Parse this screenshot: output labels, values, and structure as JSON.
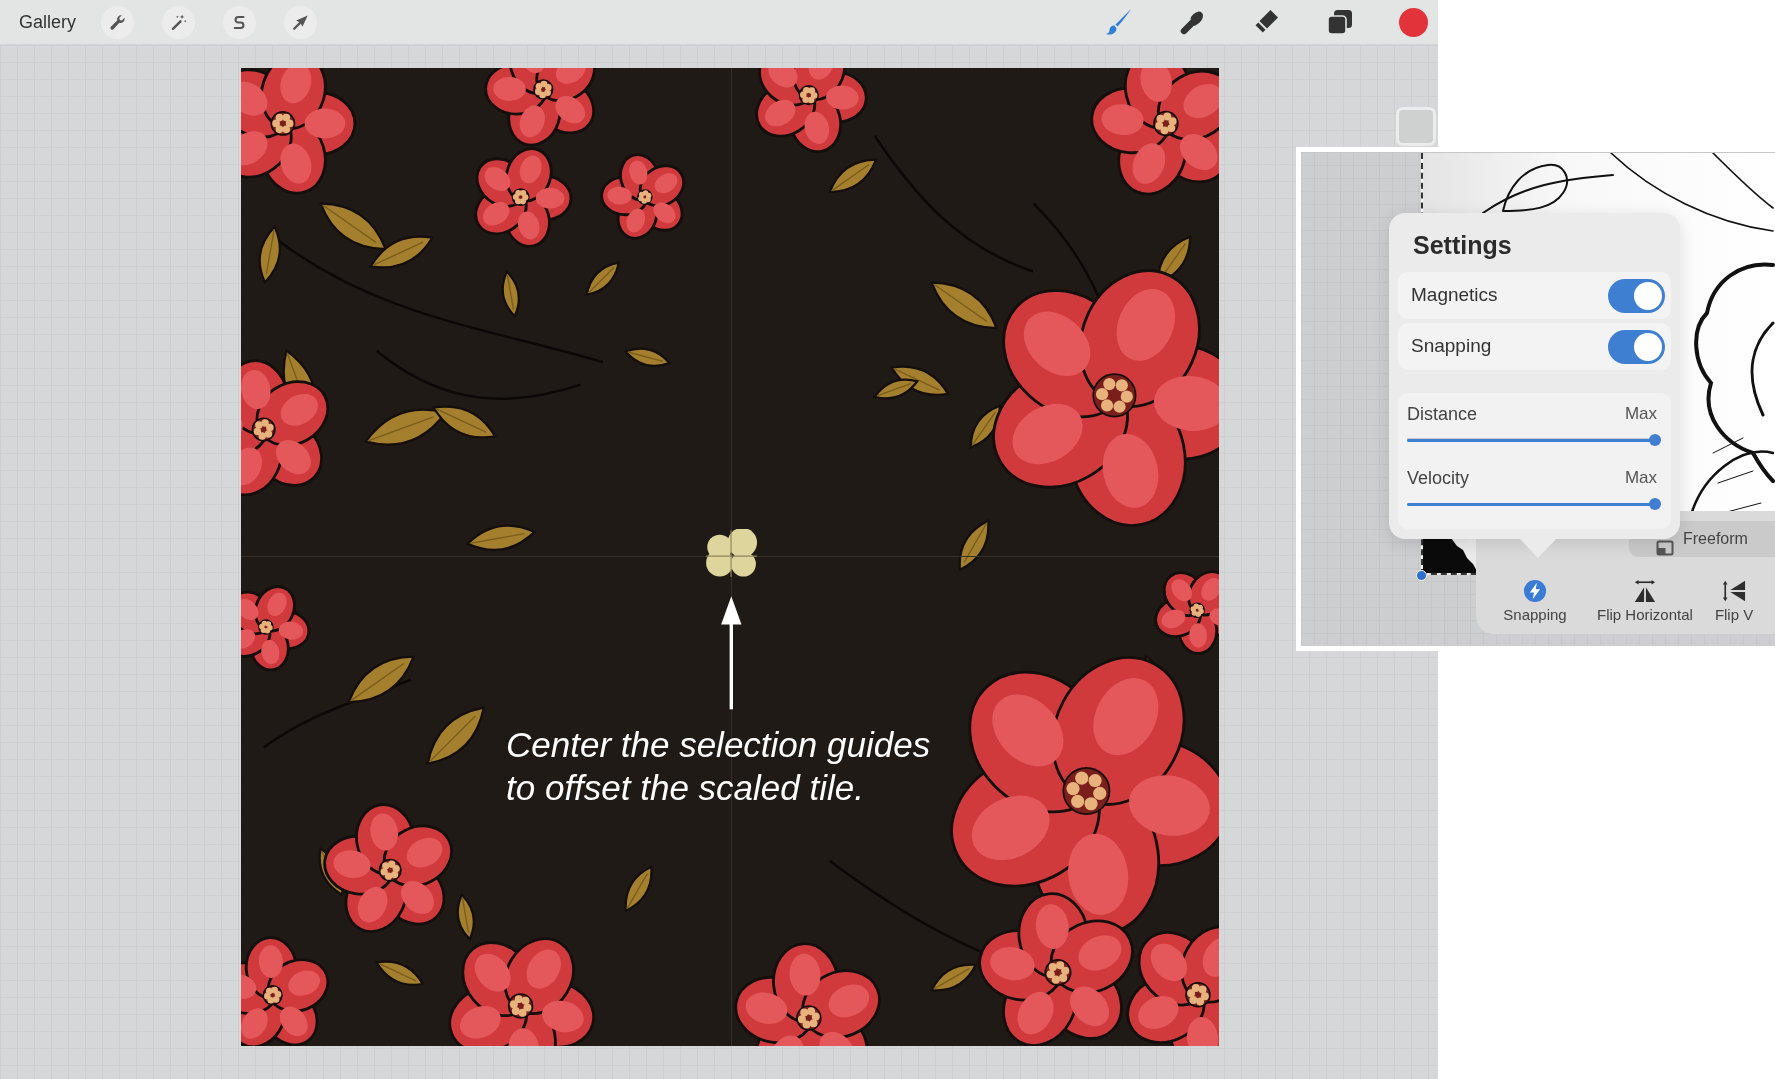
{
  "toolbar": {
    "gallery": "Gallery",
    "tools": [
      {
        "kind": "brush",
        "selected": true
      },
      {
        "kind": "smudge",
        "selected": false
      },
      {
        "kind": "eraser",
        "selected": false
      }
    ],
    "color_swatch": {
      "color": "#e2333a"
    }
  },
  "canvas": {
    "caption": "Center the selection guides\nto offset the scaled tile."
  },
  "inset": {
    "settings": {
      "title": "Settings",
      "toggles": [
        {
          "label": "Magnetics",
          "on": true
        },
        {
          "label": "Snapping",
          "on": true
        }
      ],
      "sliders": [
        {
          "label": "Distance",
          "reading": "Max",
          "level": 1
        },
        {
          "label": "Velocity",
          "reading": "Max",
          "level": 1
        }
      ]
    },
    "freeform_button": {
      "label": "Freeform"
    },
    "transform_tools": [
      {
        "kind": "snapping",
        "label": "Snapping",
        "selected": true
      },
      {
        "kind": "flip_horizontal",
        "label": "Flip Horizontal",
        "selected": false
      },
      {
        "kind": "flip_vertical",
        "label": "Flip V",
        "selected": false
      }
    ]
  }
}
